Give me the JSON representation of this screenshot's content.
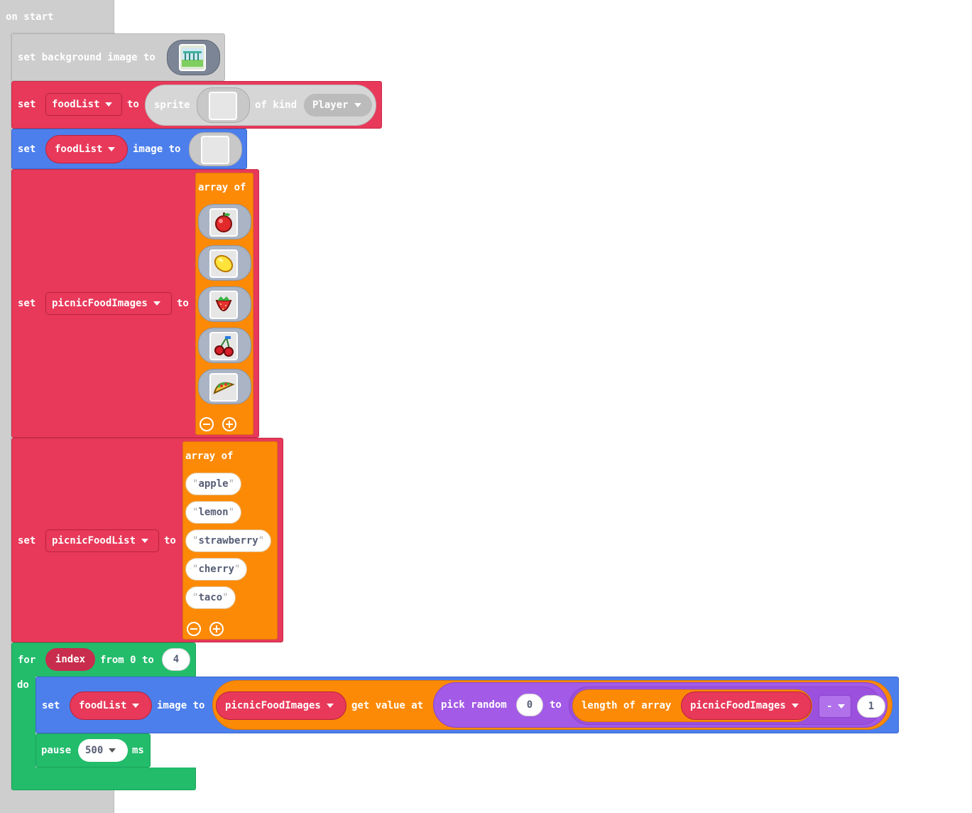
{
  "on_start": {
    "label": "on start"
  },
  "bg": {
    "label": "set background image to",
    "image_icon": "park-background-thumbnail"
  },
  "sprite_set": {
    "set_label": "set",
    "variable": "foodList",
    "to_label": "to",
    "sprite_label": "sprite",
    "of_kind_label": "of kind",
    "kind": "Player"
  },
  "image_set": {
    "set_label": "set",
    "variable": "foodList",
    "image_to_label": "image to"
  },
  "images_array": {
    "set_label": "set",
    "variable": "picnicFoodImages",
    "to_label": "to",
    "array_label": "array of",
    "items": [
      "apple-icon",
      "lemon-icon",
      "strawberry-icon",
      "cherry-icon",
      "taco-icon"
    ]
  },
  "names_array": {
    "set_label": "set",
    "variable": "picnicFoodList",
    "to_label": "to",
    "array_label": "array of",
    "items": [
      "apple",
      "lemon",
      "strawberry",
      "cherry",
      "taco"
    ],
    "quote": "\""
  },
  "loop": {
    "for_label": "for",
    "var": "index",
    "from_label": "from 0 to",
    "end": "4",
    "do_label": "do",
    "set_label": "set",
    "variable": "foodList",
    "image_to_label": "image to",
    "array_var": "picnicFoodImages",
    "get_value_label": "get value at",
    "pick_random_label": "pick random",
    "rand_min": "0",
    "to_label": "to",
    "length_label": "length of array",
    "length_var": "picnicFoodImages",
    "op": "-",
    "op_value": "1",
    "pause_label": "pause",
    "pause_value": "500",
    "ms_label": "ms"
  },
  "colors": {
    "variables": "#e8395a",
    "sprites": "#4c7fec",
    "loops": "#22bc6b",
    "arrays": "#fd8a06",
    "math": "#a35ae6",
    "scene": "#cdcdcd"
  }
}
